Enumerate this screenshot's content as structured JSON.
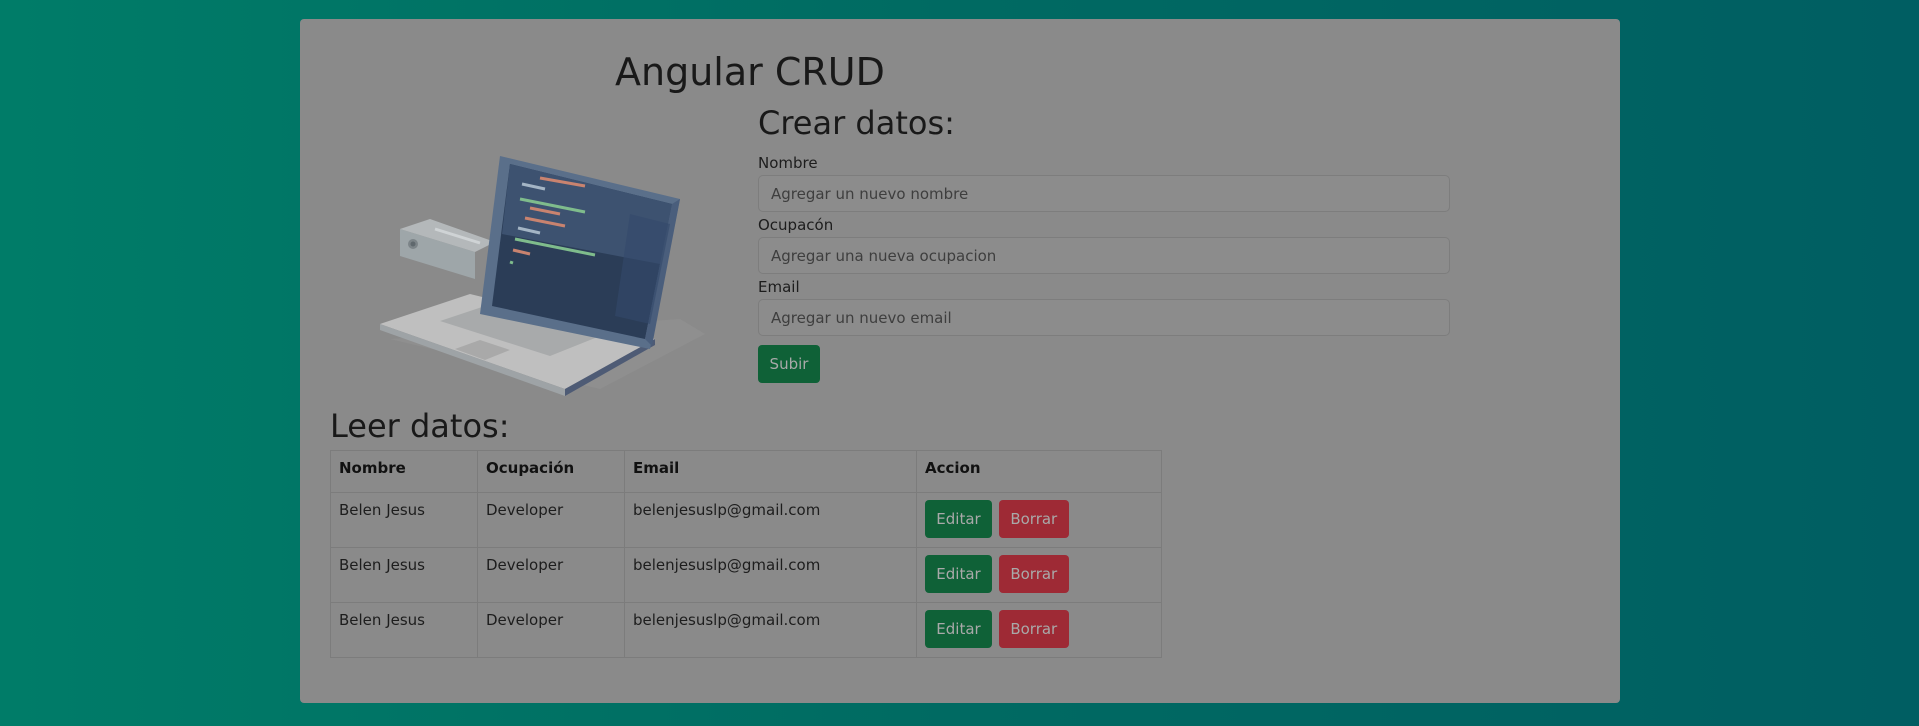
{
  "app": {
    "title": "Angular CRUD"
  },
  "create": {
    "heading": "Crear datos:",
    "fields": [
      {
        "label": "Nombre",
        "placeholder": "Agregar un nuevo nombre",
        "value": ""
      },
      {
        "label": "Ocupacón",
        "placeholder": "Agregar una nueva ocupacion",
        "value": ""
      },
      {
        "label": "Email",
        "placeholder": "Agregar un nuevo email",
        "value": ""
      }
    ],
    "submit_label": "Subir"
  },
  "read": {
    "heading": "Leer datos:",
    "columns": [
      "Nombre",
      "Ocupación",
      "Email",
      "Accion"
    ],
    "rows": [
      {
        "name": "Belen Jesus",
        "occupation": "Developer",
        "email": "belenjesuslp@gmail.com"
      },
      {
        "name": "Belen Jesus",
        "occupation": "Developer",
        "email": "belenjesuslp@gmail.com"
      },
      {
        "name": "Belen Jesus",
        "occupation": "Developer",
        "email": "belenjesuslp@gmail.com"
      }
    ],
    "edit_label": "Editar",
    "delete_label": "Borrar"
  },
  "icons": {
    "illustration": "laptop-code-illustration"
  },
  "colors": {
    "background_start": "#007c68",
    "background_end": "#005e62",
    "card": "#8a8a8a",
    "primary_button": "#0f6137",
    "danger_button": "#9e2a35"
  }
}
